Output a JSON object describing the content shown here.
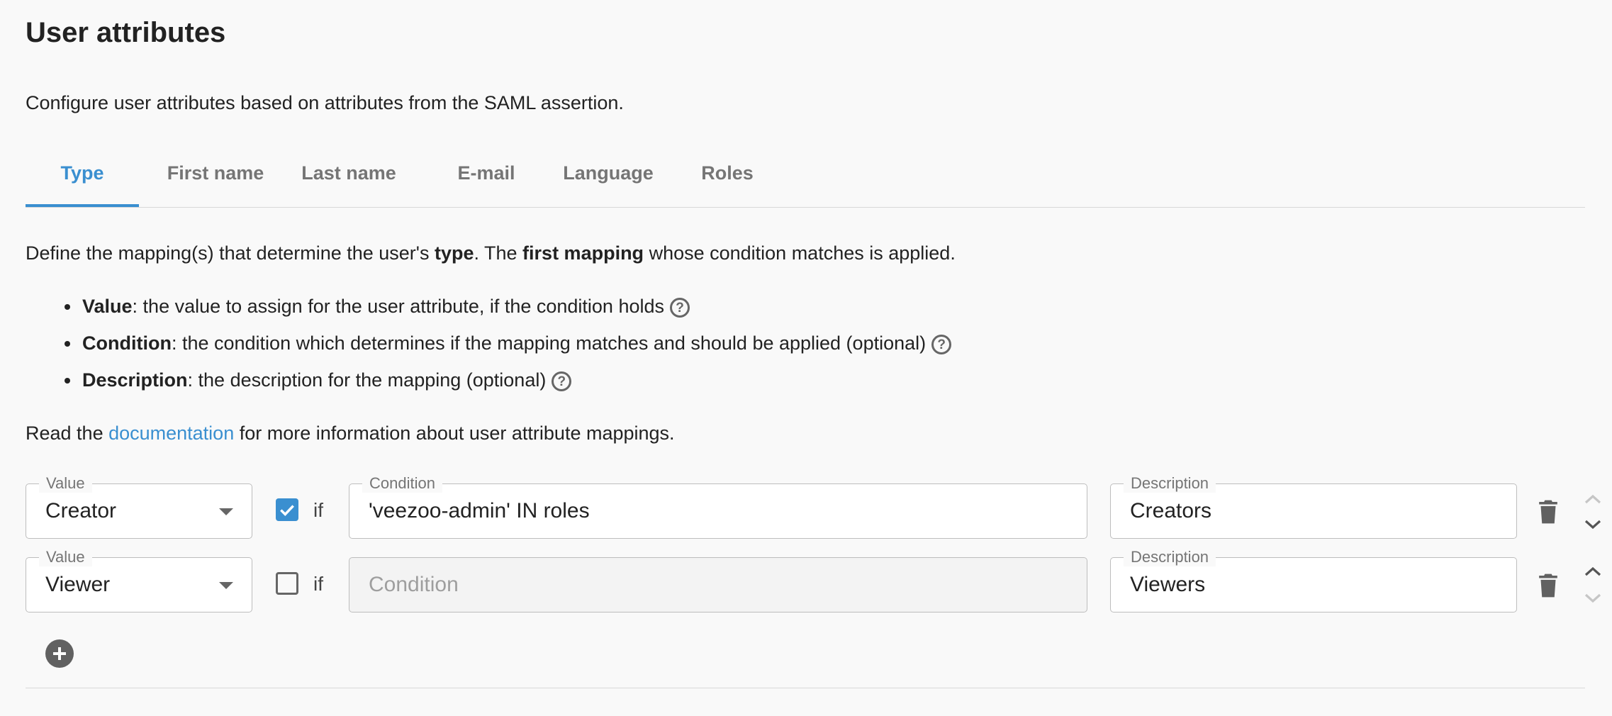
{
  "page": {
    "title": "User attributes",
    "subtitle": "Configure user attributes based on attributes from the SAML assertion."
  },
  "tabs": [
    {
      "label": "Type",
      "active": true
    },
    {
      "label": "First name",
      "active": false
    },
    {
      "label": "Last name",
      "active": false
    },
    {
      "label": "E-mail",
      "active": false
    },
    {
      "label": "Language",
      "active": false
    },
    {
      "label": "Roles",
      "active": false
    }
  ],
  "intro": {
    "part1": "Define the mapping(s) that determine the user's ",
    "bold1": "type",
    "part2": ". The ",
    "bold2": "first mapping",
    "part3": " whose condition matches is applied."
  },
  "bullets": [
    {
      "term": "Value",
      "text": ": the value to assign for the user attribute, if the condition holds"
    },
    {
      "term": "Condition",
      "text": ": the condition which determines if the mapping matches and should be applied (optional)"
    },
    {
      "term": "Description",
      "text": ": the description for the mapping (optional)"
    }
  ],
  "help_icon": {
    "glyph": "?",
    "name": "help-circle-icon"
  },
  "docs": {
    "before": "Read the ",
    "link": "documentation",
    "after": " for more information about user attribute mappings."
  },
  "labels": {
    "value": "Value",
    "condition": "Condition",
    "description": "Description",
    "if": "if"
  },
  "mappings": [
    {
      "value": "Creator",
      "condition_enabled": true,
      "condition": "'veezoo-admin' IN roles",
      "condition_placeholder": "Condition",
      "description": "Creators"
    },
    {
      "value": "Viewer",
      "condition_enabled": false,
      "condition": "",
      "condition_placeholder": "Condition",
      "description": "Viewers"
    }
  ],
  "colors": {
    "accent": "#3a8fd0",
    "text": "#222222",
    "muted": "#757575",
    "background": "#f9f9f9",
    "icon": "#616161"
  }
}
